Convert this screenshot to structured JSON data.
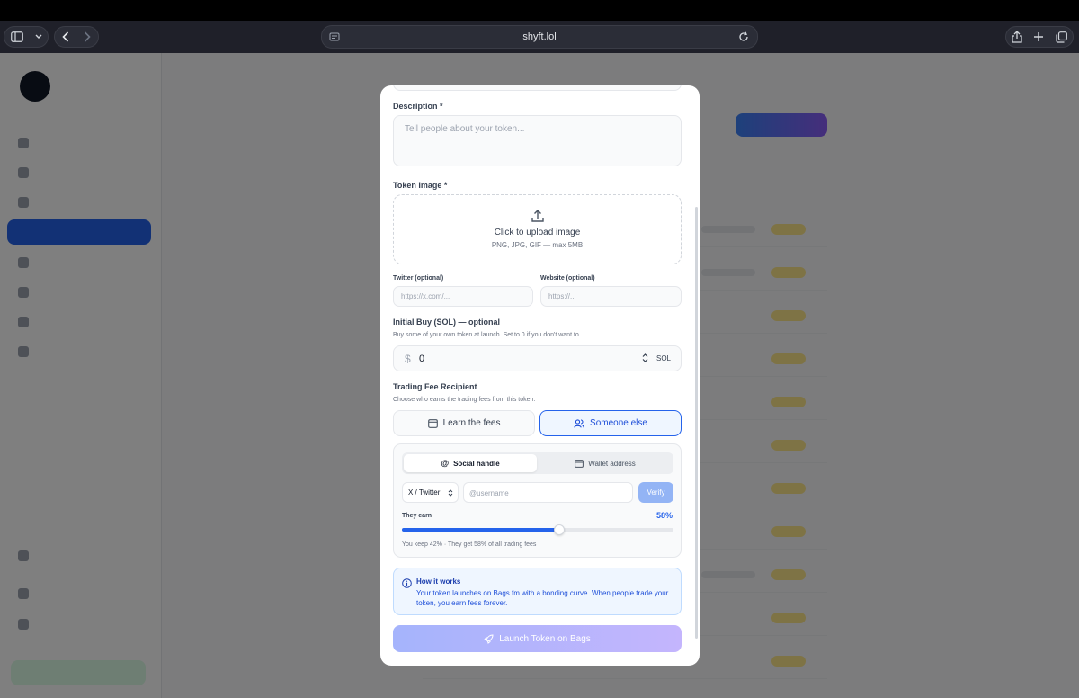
{
  "browser": {
    "url": "shyft.lol"
  },
  "form": {
    "description": {
      "label": "Description *",
      "placeholder": "Tell people about your token..."
    },
    "token_image": {
      "label": "Token Image *",
      "title": "Click to upload image",
      "subtitle": "PNG, JPG, GIF — max 5MB"
    },
    "twitter": {
      "label": "Twitter (optional)",
      "placeholder": "https://x.com/..."
    },
    "website": {
      "label": "Website (optional)",
      "placeholder": "https://..."
    },
    "initial_buy": {
      "label": "Initial Buy (SOL) — optional",
      "helper": "Buy some of your own token at launch. Set to 0 if you don't want to.",
      "currency_symbol": "$",
      "value": "0",
      "unit": "SOL"
    },
    "fee_recipient": {
      "label": "Trading Fee Recipient",
      "helper": "Choose who earns the trading fees from this token.",
      "options": [
        "I earn the fees",
        "Someone else"
      ],
      "selected": "Someone else"
    },
    "recipient_panel": {
      "tabs": [
        "Social handle",
        "Wallet address"
      ],
      "active_tab": "Social handle",
      "platform": "X / Twitter",
      "username_placeholder": "@username",
      "verify_label": "Verify",
      "they_earn_label": "They earn",
      "they_earn_pct_text": "58%",
      "they_earn_value": 0.58,
      "note": "You keep 42% · They get 58% of all trading fees"
    },
    "info": {
      "title": "How it works",
      "body": "Your token launches on Bags.fm with a bonding curve. When people trade your token, you earn fees forever."
    },
    "submit_label": "Launch Token on Bags"
  },
  "colors": {
    "accent": "#2563eb",
    "launch_gradient_start": "#a5b4fc",
    "launch_gradient_end": "#c4b5fd"
  }
}
